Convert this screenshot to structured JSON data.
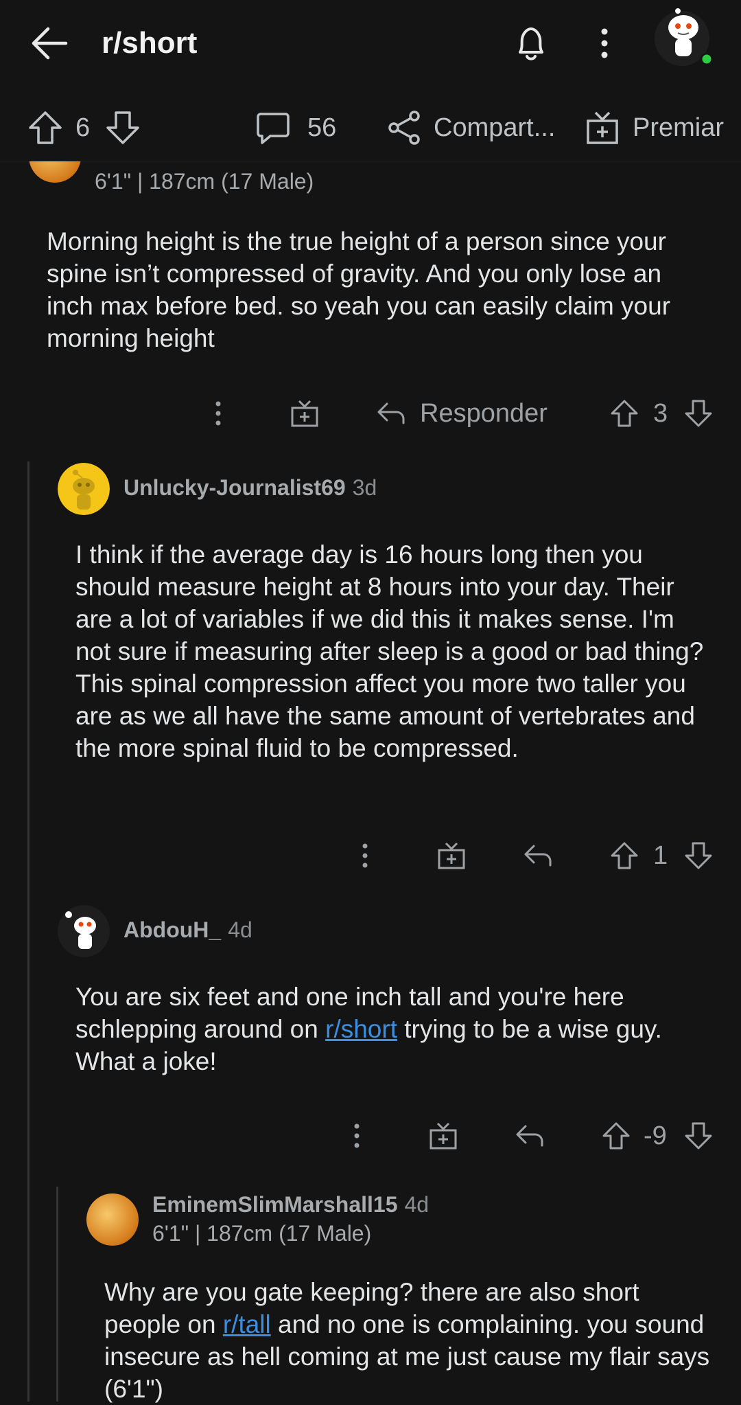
{
  "header": {
    "title": "r/short"
  },
  "post_actions": {
    "upvotes": "6",
    "comments": "56",
    "share_label": "Compart...",
    "award_label": "Premiar"
  },
  "comments": [
    {
      "flair": "6'1\" | 187cm (17 Male)",
      "body": "Morning height is the true height of a person since your spine isn’t compressed of gravity. And you only lose an inch max before bed. so yeah you can easily claim your morning height",
      "reply_label": "Responder",
      "score": "3"
    },
    {
      "author": "Unlucky-Journalist69",
      "age": "3d",
      "body": "I think if the average day is 16 hours long then you should measure height at 8 hours into your day. Their are a lot of variables if we did this it makes sense. I'm not sure if measuring after sleep is a good or bad thing? This spinal compression affect you more two taller you are as we all have the same amount of vertebrates and the more spinal fluid to be compressed.",
      "score": "1"
    },
    {
      "author": "AbdouH_",
      "age": "4d",
      "body_before": "You are six feet and one inch tall and you're here schlepping around on ",
      "link": "r/short",
      "body_after": " trying to be a wise guy. What a joke!",
      "score": "-9"
    },
    {
      "author": "EminemSlimMarshall15",
      "age": "4d",
      "flair": "6'1\" | 187cm (17 Male)",
      "body_before": "Why are you gate keeping? there are also short people on ",
      "link": "r/tall",
      "body_after": " and no one is complaining. you sound insecure as hell coming at me just cause my flair says (6'1\")"
    }
  ],
  "colors": {
    "background": "#141414",
    "link": "#3b8fe0",
    "online_dot": "#2ecc40"
  }
}
